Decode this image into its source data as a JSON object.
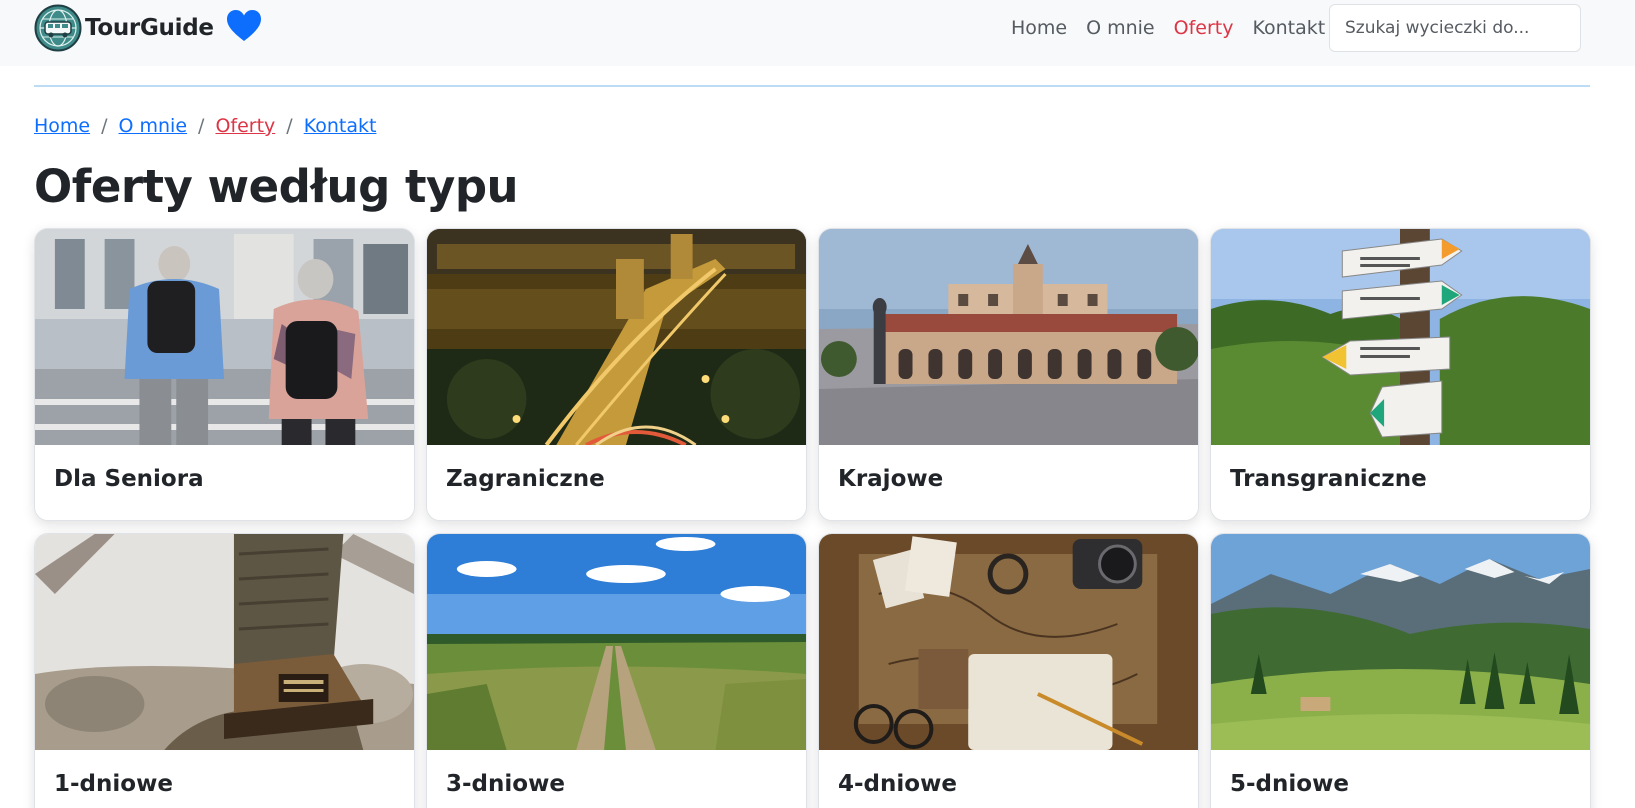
{
  "brand": {
    "name": "TourGuide",
    "logo_icon": "globe-bus-logo-icon",
    "favorite_icon": "heart-icon",
    "heart_color": "#0d6efd"
  },
  "nav": {
    "links": [
      {
        "label": "Home",
        "active": false
      },
      {
        "label": "O mnie",
        "active": false
      },
      {
        "label": "Oferty",
        "active": true
      },
      {
        "label": "Kontakt",
        "active": false
      }
    ],
    "search_placeholder": "Szukaj wycieczki do..."
  },
  "breadcrumb": {
    "items": [
      {
        "label": "Home",
        "active": false
      },
      {
        "label": "O mnie",
        "active": false
      },
      {
        "label": "Oferty",
        "active": true
      },
      {
        "label": "Kontakt",
        "active": false
      }
    ],
    "separator": "/"
  },
  "page": {
    "title": "Oferty według typu"
  },
  "cards": [
    {
      "title": "Dla Seniora",
      "image": "senior-couple-walking-photo"
    },
    {
      "title": "Zagraniczne",
      "image": "night-chain-bridge-photo"
    },
    {
      "title": "Krajowe",
      "image": "cloth-hall-square-photo"
    },
    {
      "title": "Transgraniczne",
      "image": "trail-signpost-photo"
    },
    {
      "title": "1-dniowe",
      "image": "hiking-boot-photo"
    },
    {
      "title": "3-dniowe",
      "image": "countryside-path-photo"
    },
    {
      "title": "4-dniowe",
      "image": "vintage-map-camera-photo"
    },
    {
      "title": "5-dniowe",
      "image": "mountain-valley-photo"
    }
  ],
  "colors": {
    "accent": "#dc3545",
    "link": "#0d6efd",
    "navbar_bg": "#f8f9fa"
  }
}
